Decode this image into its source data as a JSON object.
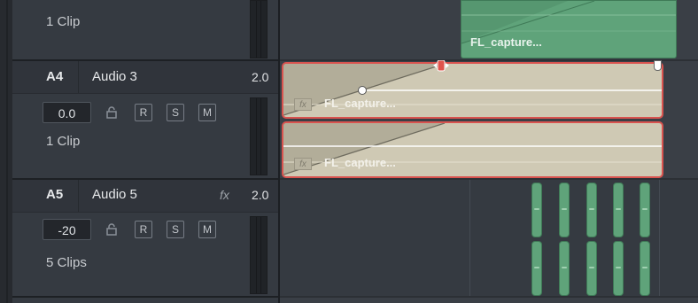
{
  "tracks": [
    {
      "clip_count": "1 Clip"
    },
    {
      "id": "A4",
      "name": "Audio 3",
      "channels": "2.0",
      "volume": "0.0",
      "buttons": {
        "record": "R",
        "solo": "S",
        "mute": "M"
      },
      "clip_count": "1 Clip"
    },
    {
      "id": "A5",
      "name": "Audio 5",
      "fx": "fx",
      "channels": "2.0",
      "volume": "-20",
      "buttons": {
        "record": "R",
        "solo": "S",
        "mute": "M"
      },
      "clip_count": "5 Clips"
    }
  ],
  "timeline": {
    "video_clip": {
      "name": "FL_capture..."
    },
    "audio_clips": [
      {
        "name": "FL_capture...",
        "fx_badge": "fx"
      },
      {
        "name": "FL_capture...",
        "fx_badge": "fx"
      }
    ],
    "short_clip_count": 5
  },
  "colors": {
    "clip_green": "#5fa37a",
    "audio_clip": "#cfc9b4",
    "selection_red": "#d9534f"
  }
}
